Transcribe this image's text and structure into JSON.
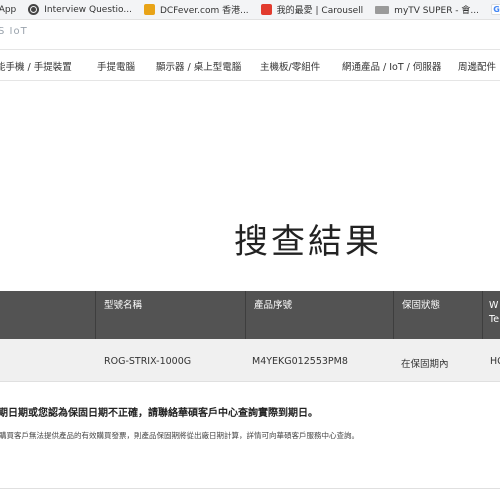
{
  "bookmarks": [
    {
      "label": "sApp",
      "icon": "whatsapp-icon"
    },
    {
      "label": "Interview Questio...",
      "icon": "globe-icon"
    },
    {
      "label": "DCFever.com 香港...",
      "icon": "dcfever-icon"
    },
    {
      "label": "我的最愛 | Carousell",
      "icon": "carousell-icon"
    },
    {
      "label": "myTV SUPER - 會...",
      "icon": "mytv-icon"
    },
    {
      "label": "G",
      "icon": "google-icon"
    }
  ],
  "brand": "S IoT",
  "nav": [
    "能手機 / 手提裝置",
    "手提電腦",
    "顯示器 / 桌上型電腦",
    "主機板/零組件",
    "網通產品 / IoT / 伺服器",
    "周邊配件"
  ],
  "page_title": "搜查結果",
  "table": {
    "headers": [
      "型號名稱",
      "產品序號",
      "保固狀態",
      "W Te"
    ],
    "row": [
      "ROG-STRIX-1000G",
      "M4YEKG012553PM8",
      "在保固期內",
      "HC"
    ]
  },
  "warning": "期日期或您認為保固日期不正確，請聯絡華碩客戶中心查詢實際到期日。",
  "note": "購買客戶無法提供產品的有效購買發票，則產品保固期將從出廠日期計算，詳情可向華碩客戶服務中心查詢。"
}
